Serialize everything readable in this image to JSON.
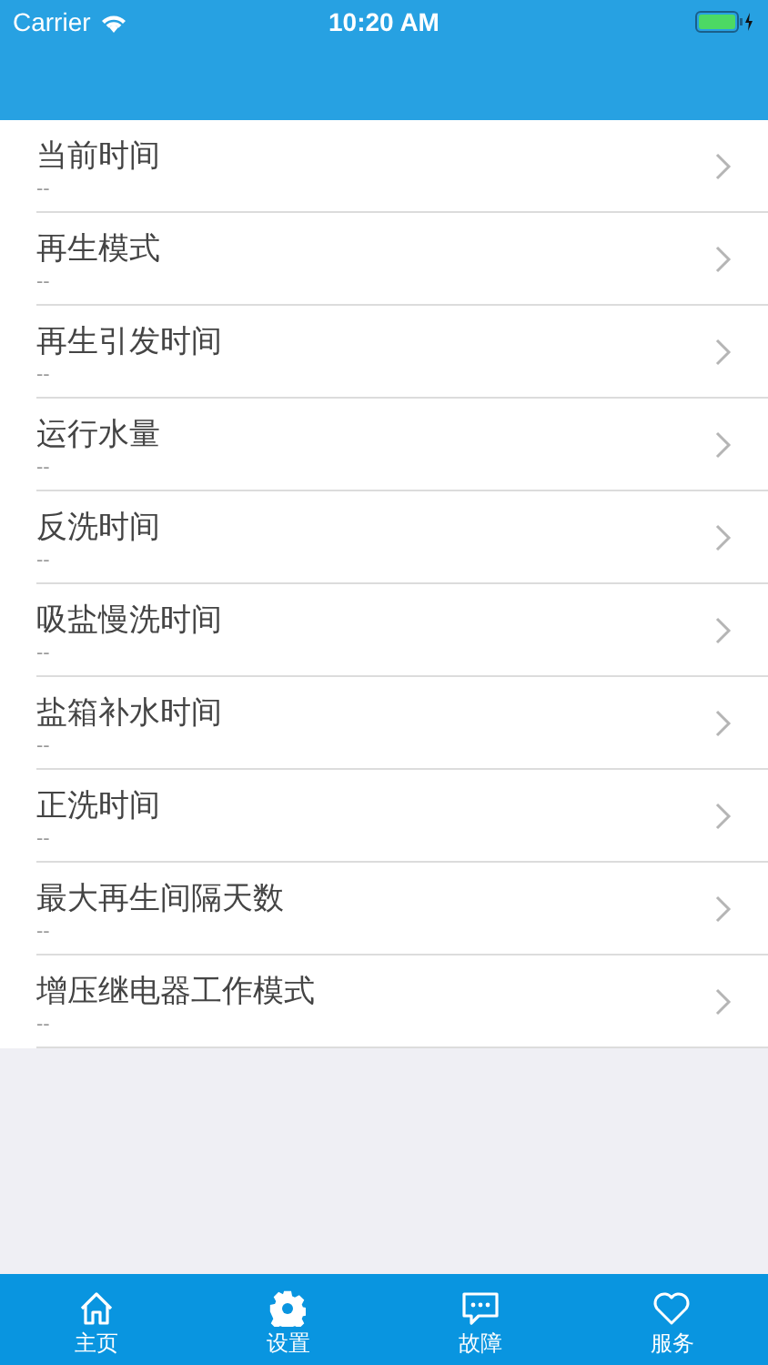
{
  "status_bar": {
    "carrier": "Carrier",
    "time": "10:20 AM"
  },
  "settings": [
    {
      "label": "当前时间",
      "value": "--"
    },
    {
      "label": "再生模式",
      "value": "--"
    },
    {
      "label": "再生引发时间",
      "value": "--"
    },
    {
      "label": "运行水量",
      "value": "--"
    },
    {
      "label": "反洗时间",
      "value": "--"
    },
    {
      "label": "吸盐慢洗时间",
      "value": "--"
    },
    {
      "label": "盐箱补水时间",
      "value": "--"
    },
    {
      "label": "正洗时间",
      "value": "--"
    },
    {
      "label": "最大再生间隔天数",
      "value": "--"
    },
    {
      "label": "增压继电器工作模式",
      "value": "--"
    }
  ],
  "tab_bar": [
    {
      "kind": "home",
      "label": "主页",
      "selected": false
    },
    {
      "kind": "settings",
      "label": "设置",
      "selected": true
    },
    {
      "kind": "fault",
      "label": "故障",
      "selected": false
    },
    {
      "kind": "service",
      "label": "服务",
      "selected": false
    }
  ]
}
